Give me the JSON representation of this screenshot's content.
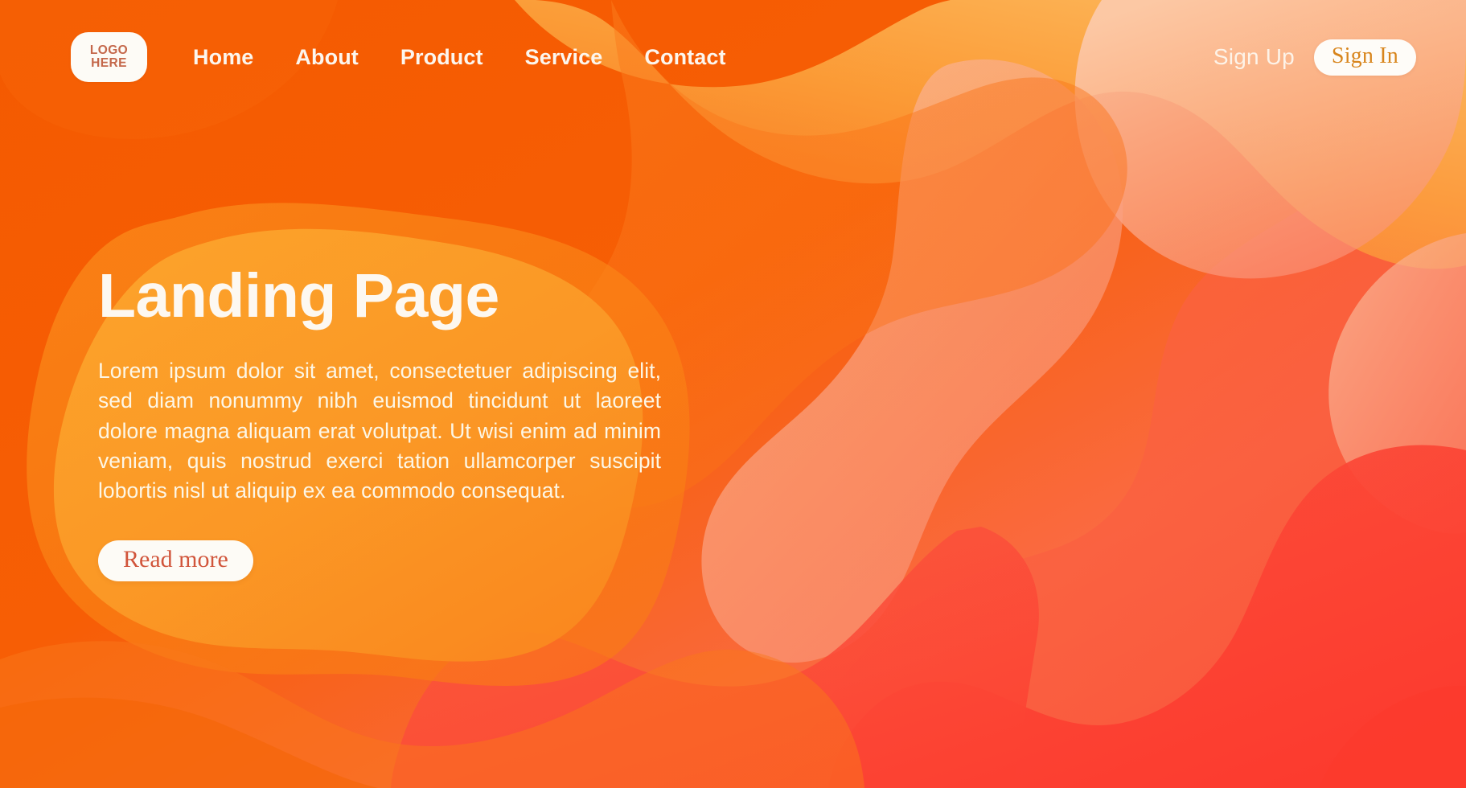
{
  "page": {
    "title": "Landing Page",
    "base_color": "#F45A00"
  },
  "navbar": {
    "logo": {
      "line1": "LOGO",
      "line2": "HERE",
      "text_color": "#C4674A",
      "bg_color": "#FDFBF6"
    },
    "links": [
      {
        "label": "Home"
      },
      {
        "label": "About"
      },
      {
        "label": "Product"
      },
      {
        "label": "Service"
      },
      {
        "label": "Contact"
      }
    ],
    "auth": {
      "signup_label": "Sign Up",
      "signin_label": "Sign In",
      "signin_text_color": "#D8851C",
      "signin_bg_color": "#FEFCF8"
    }
  },
  "hero": {
    "heading": "Landing Page",
    "body": "Lorem ipsum dolor sit amet, consectetuer adipiscing elit, sed diam nonummy nibh euismod tincidunt ut laoreet dolore magna aliquam erat volutpat. Ut wisi enim ad minim veniam, quis nostrud exerci tation ullamcorper suscipit lobortis nisl ut aliquip ex ea commodo consequat.",
    "cta_label": "Read more",
    "cta_text_color": "#D1553B",
    "cta_bg_color": "#FDFBF6",
    "heading_color": "#FDF8F1",
    "body_color": "#FDF6E5"
  },
  "background": {
    "type": "abstract-fluid-blobs",
    "palette": {
      "base_orange": "#F45A00",
      "deep_orange": "#F05A08",
      "mid_orange": "#F97A18",
      "amber": "#FBA12B",
      "light_amber": "#FBB43F",
      "peach": "#F9A87E",
      "pale_peach": "#F7C0A0",
      "coral": "#FA6A4E",
      "red": "#FA3E32",
      "bright_red": "#FC4033"
    }
  }
}
